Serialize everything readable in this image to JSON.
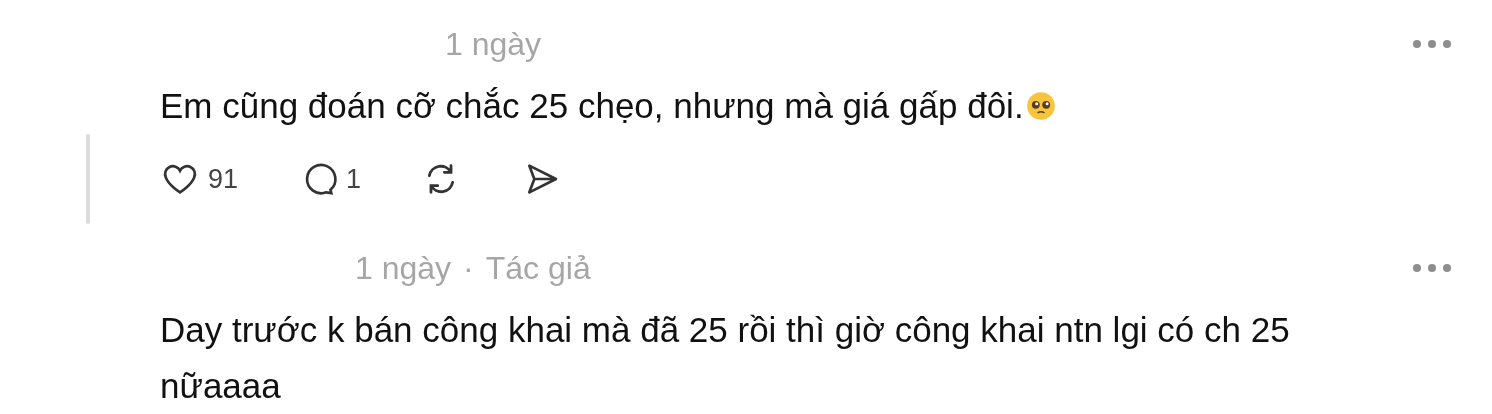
{
  "comments": [
    {
      "time": "1 ngày",
      "text": "Em cũng đoán cỡ chắc 25 chẹo, nhưng mà giá gấp đôi.",
      "emoji": true,
      "actions": {
        "likes": "91",
        "replies": "1"
      }
    },
    {
      "time": "1 ngày",
      "separator": "·",
      "author_badge": "Tác giả",
      "text": "Day trước k bán công khai mà đã 25 rồi thì giờ công khai ntn lgi có ch 25 nữaaaa"
    }
  ]
}
